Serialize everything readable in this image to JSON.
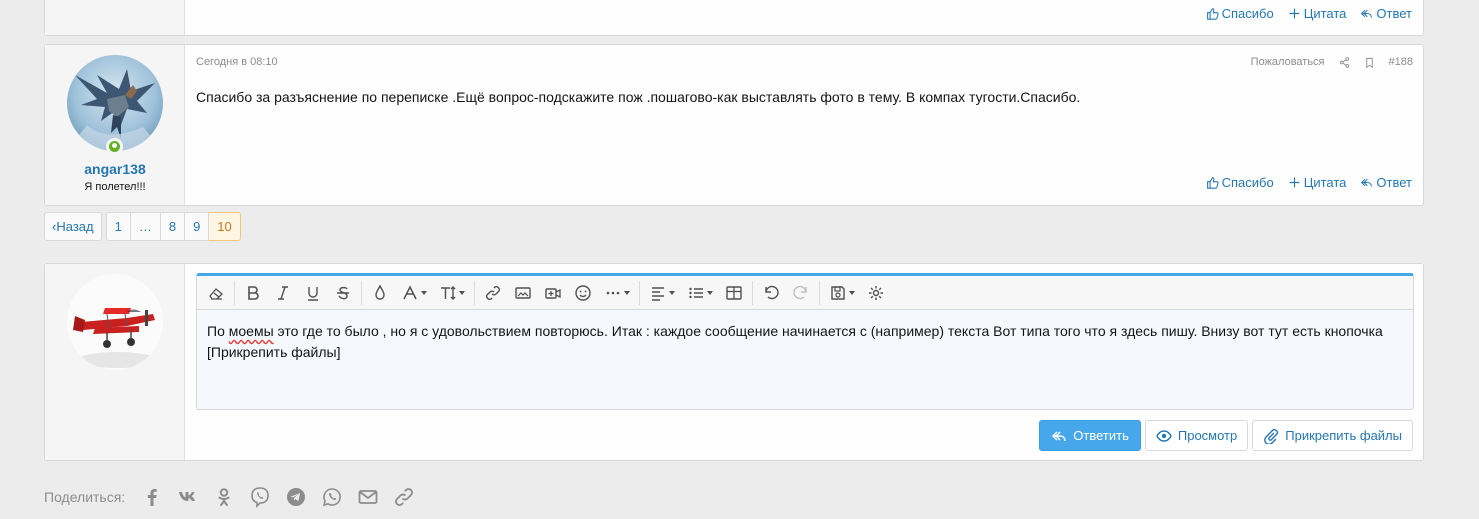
{
  "post_actions": {
    "like": "Спасибо",
    "quote": "Цитата",
    "reply": "Ответ"
  },
  "post": {
    "date": "Сегодня в 08:10",
    "report": "Пожаловаться",
    "number": "#188",
    "text": "Спасибо за разъяснение по переписке .Ещё вопрос-подскажите пож .пошагово-как выставлять фото в тему. В компах тугости.Спасибо.",
    "author": {
      "username": "angar138",
      "title": "Я полетел!!!",
      "online": true
    }
  },
  "pagination": {
    "prev": "Назад",
    "pages": [
      "1",
      "…",
      "8",
      "9",
      "10"
    ],
    "current": "10"
  },
  "reply": {
    "text_before_spell": "По ",
    "text_spell": "моемы",
    "text_after_spell": " это где то было , но я с удовольствием повторюсь. Итак : каждое сообщение начинается с (например) текста Вот типа того что я здесь пишу. Внизу вот тут есть кнопочка [Прикрепить файлы]",
    "submit": "Ответить",
    "preview": "Просмотр",
    "attach": "Прикрепить файлы"
  },
  "share": {
    "label": "Поделиться:",
    "icons": [
      "facebook-icon",
      "vk-icon",
      "odnoklassniki-icon",
      "viber-icon",
      "telegram-icon",
      "whatsapp-icon",
      "email-icon",
      "link-icon"
    ]
  },
  "colors": {
    "link": "#2577b1",
    "accent": "#47a7eb",
    "online": "#63b224",
    "current_page_bg": "#fef6e3"
  }
}
